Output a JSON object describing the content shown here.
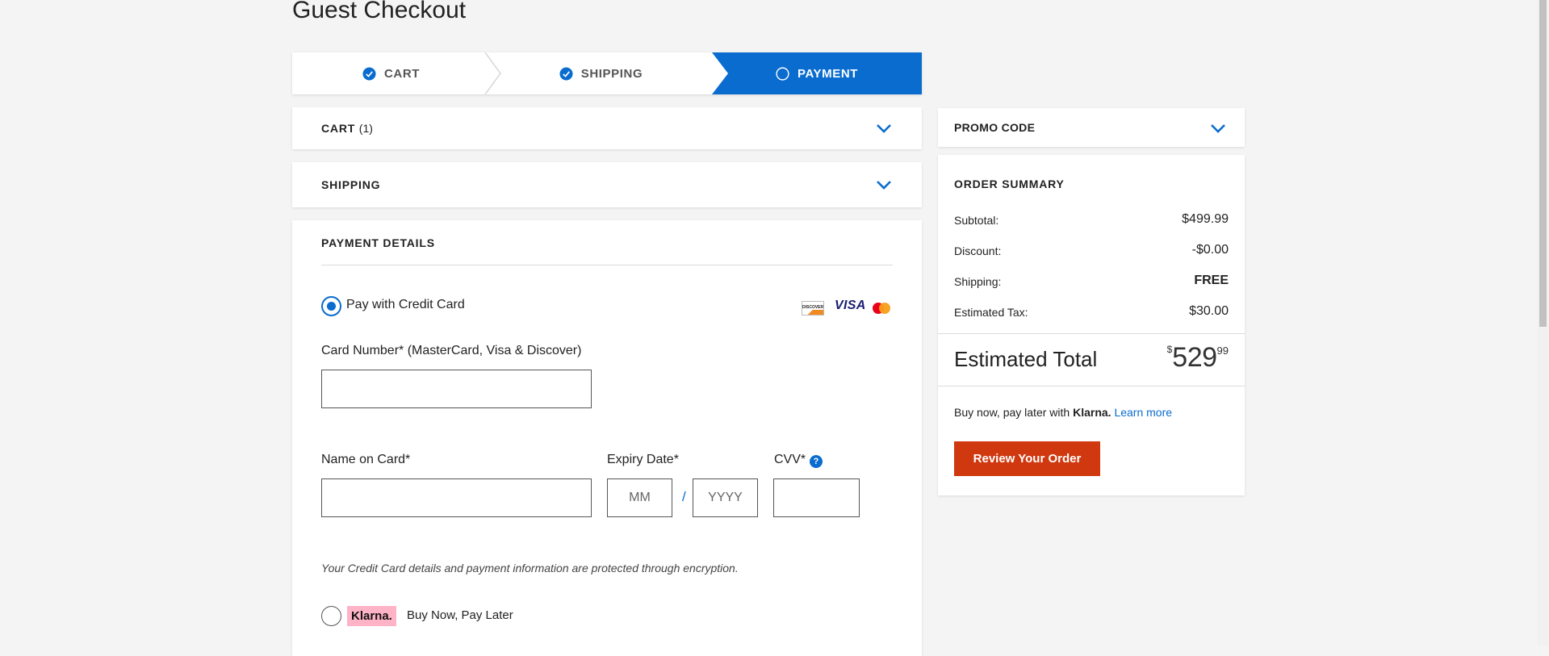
{
  "page": {
    "title": "Guest Checkout"
  },
  "stepper": {
    "steps": [
      {
        "label": "CART",
        "state": "completed"
      },
      {
        "label": "SHIPPING",
        "state": "completed"
      },
      {
        "label": "PAYMENT",
        "state": "active"
      }
    ]
  },
  "cart_section": {
    "label": "CART",
    "count": "(1)"
  },
  "shipping_section": {
    "label": "SHIPPING"
  },
  "payment": {
    "title": "PAYMENT DETAILS",
    "credit_option_label": "Pay with Credit Card",
    "card_brands": [
      "DISCOVER",
      "VISA",
      "mastercard-icon"
    ],
    "card_number_label": "Card Number* (MasterCard, Visa & Discover)",
    "card_number_value": "",
    "name_label": "Name on Card*",
    "name_value": "",
    "expiry_label": "Expiry Date*",
    "expiry_month_placeholder": "MM",
    "expiry_separator": "/",
    "expiry_year_placeholder": "YYYY",
    "cvv_label": "CVV*",
    "cvv_help": "?",
    "security_note": "Your Credit Card details and payment information are protected through encryption.",
    "klarna_badge": "Klarna.",
    "klarna_option_label": "Buy Now, Pay Later"
  },
  "promo": {
    "label": "PROMO CODE"
  },
  "summary": {
    "title": "ORDER SUMMARY",
    "rows": [
      {
        "label": "Subtotal:",
        "value": "$499.99"
      },
      {
        "label": "Discount:",
        "value": "-$0.00"
      },
      {
        "label": "Shipping:",
        "value": "FREE"
      },
      {
        "label": "Estimated Tax:",
        "value": "$30.00"
      }
    ],
    "total_label": "Estimated Total",
    "total_currency": "$",
    "total_dollars": "529",
    "total_cents": "99",
    "klarna_text": "Buy now, pay later with",
    "klarna_brand": "Klarna.",
    "klarna_link": "Learn more",
    "review_button": "Review Your Order"
  },
  "colors": {
    "accent": "#0a6ccf",
    "button": "#d0380f",
    "klarna_pink": "#ffb3c7"
  }
}
